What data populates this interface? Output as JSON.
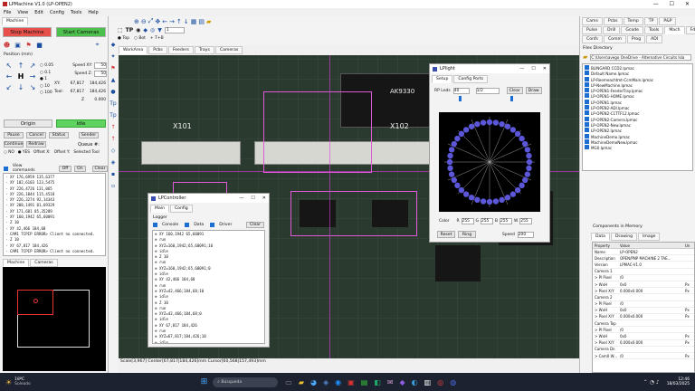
{
  "app": {
    "title": "LPMachine V1.0 (LP-OPEN2)",
    "menu": [
      "File",
      "View",
      "Edit",
      "Config",
      "Tools",
      "Help"
    ]
  },
  "left": {
    "machine_tab": "Machine",
    "stop": "Stop Machine",
    "start": "Start Cameras",
    "pos_title": "Position (mm)",
    "speeds": [
      {
        "l": "Speed XY:",
        "v": "50"
      },
      {
        "l": "Speed Z:",
        "v": "50"
      }
    ],
    "coords": [
      {
        "l": "XY:",
        "a": "67,817",
        "b": "184,426"
      },
      {
        "l": "Tool:",
        "a": "67,817",
        "b": "184,426"
      },
      {
        "l": "Z",
        "a": "",
        "b": "0.000"
      }
    ],
    "steps": [
      "0.05",
      "0.1",
      "1",
      "10",
      "100"
    ],
    "origin": "Origin",
    "status": "Idle",
    "pause": "Pause",
    "cancel": "Cancel",
    "status_btn": "Status",
    "sender": "Sender",
    "continue": "Continue",
    "redraw": "Redraw",
    "queue": "Queue #:",
    "radio_no": "NO",
    "radio_yes": "YES",
    "offset_x": "Offset X:",
    "offset_y": "Offset Y:",
    "selected_tool": "Selected Tool",
    "view_commands": "View commands",
    "off": "Off",
    "on": "On",
    "clear": "Clear",
    "log": [
      "XY 176,6959 135,6377",
      "XY 182,6103 123,5475",
      "XY 226,4726 131,065",
      "XY 226,1044 115,4518",
      "XY 226,3274 92,14343",
      "XY 208,1491 81,69329",
      "XY 171,681 85,35289",
      "XY 160,1942 65,60091",
      "Z 10",
      "XY 42,466 184,68",
      "CAM1 TCPIP ERROR> Client no connected.",
      "Z 10",
      "XY 67,817 184,426",
      "CAM1 TCPIP ERROR> Client no connected."
    ],
    "bottom_tabs": [
      "Machine",
      "Cameras"
    ]
  },
  "center": {
    "tabs": [
      "WorkArea",
      "Pcbs",
      "Feeders",
      "Trays",
      "Cameras"
    ],
    "top": "Top",
    "bot": "Bot",
    "tb": "+ T+B",
    "zoom": "1",
    "status": "Scale[3,967]   Center[67,817|184,426]mm   Cursor[60,568|157,493]mm",
    "pcb_labels": [
      "X101",
      "X102",
      "AK9330"
    ]
  },
  "lpc": {
    "title": "LPController",
    "tabs": [
      "Main",
      "Config"
    ],
    "logger": "Logger",
    "console": "Console",
    "data": "Data",
    "driver": "Driver",
    "clear": "Clear",
    "lines": [
      "XY 160,1942 65,60091",
      "run",
      "XYZ=160,1942;65,60091;10",
      "idle",
      "Z 10",
      "run",
      "XYZ=160,1942;65,60091;0",
      "idle",
      "XY 42,466 184,68",
      "run",
      "XYZ=42,466;184,68;10",
      "idle",
      "Z 10",
      "run",
      "XYZ=42,466;184,68;0",
      "idle",
      "XY 67,817 184,426",
      "run",
      "XYZ=67,817;184,426;10",
      "idle"
    ]
  },
  "lpl": {
    "title": "LPlight",
    "tabs": [
      "Setup",
      "Config Ports"
    ],
    "rp": "RP Leds",
    "rp_val": "40",
    "sel_val": "1/2",
    "clear": "Clear",
    "draw": "Draw",
    "color": "Color",
    "r": "R",
    "rv": "255",
    "g": "G",
    "gv": "255",
    "b": "B",
    "bv": "255",
    "w": "W",
    "wv": "255",
    "reset": "Reset",
    "ring": "Ring",
    "speed": "Speed",
    "speed_v": "200"
  },
  "right": {
    "tabs1": [
      "Cams",
      "Pcbs",
      "Temp",
      "TP",
      "P&P"
    ],
    "tabs2": [
      "Pulse",
      "Drill",
      "Gcode",
      "Tools",
      "Mach",
      "Fdrs"
    ],
    "tabs3": [
      "Confs",
      "Comm",
      "Prog",
      "ADI"
    ],
    "dir_title": "Files Directory",
    "path": "C:\\Users\\avego OneDrive - Alternative Circuits Isla",
    "files": [
      "BLINGARD CCD2.lpmac",
      "Default Name.lpmac",
      "LP-Reemeachtmt-CcmMain.lpmac",
      "LP-NewMachine.lpmac",
      "LP-OPEN1-FeederTray.lpmac",
      "LP-OPEN1-HOME.lpmac",
      "LP-OPEN1.lpmac",
      "LP-OPEN2-ADI.lpmac",
      "LP-OPEN2-C1TTF12.lpmac",
      "LP-OPEN2-Camera.lpmac",
      "LP-OPEN2-New.lpmac",
      "LP-OPEN2.lpmac",
      "MachineDemo.lpmac",
      "MachineDemoNew.lpmac",
      "MG0.lpmac"
    ],
    "comp_title": "Components in Memory",
    "comp_tabs": [
      "Data",
      "Drawing",
      "Image"
    ],
    "hdr": [
      "Property",
      "Value",
      "Un"
    ],
    "props": [
      [
        "Name",
        "LP-OPEN2",
        ""
      ],
      [
        "Description",
        "OPEN/PNP MACHINE 2 TAE...",
        ""
      ],
      [
        "Version",
        "LPMAC-V1.0",
        ""
      ],
      [
        "Camera 1",
        "",
        ""
      ],
      [
        "> Pl Pixel",
        "/0",
        ""
      ],
      [
        "> WxH",
        "0x0",
        "Px"
      ],
      [
        "> Pixel X/Y",
        "0.000x0.000",
        "Px"
      ],
      [
        "Camera 2",
        "",
        ""
      ],
      [
        "> Pl Pixel",
        "/0",
        ""
      ],
      [
        "> WxH",
        "0x0",
        "Px"
      ],
      [
        "> Pixel X/Y",
        "0.000x0.000",
        "Px"
      ],
      [
        "Camera Top",
        "",
        ""
      ],
      [
        "> Pl Pixel",
        "/0",
        ""
      ],
      [
        "> WxH",
        "0x0",
        "Px"
      ],
      [
        "> Pixel X/Y",
        "0.000x0.000",
        "Px"
      ],
      [
        "Camera Dn",
        "",
        ""
      ],
      [
        "> Cam0 W...",
        "/0",
        "Px"
      ]
    ]
  },
  "taskbar": {
    "temp": "18ºC",
    "weather": "Soleado",
    "search": "Búsqueda",
    "time": "12:46",
    "date": "18/03/2025"
  },
  "colors": {
    "stop": "#e8504b",
    "start": "#4cc04c",
    "origin": "#e8e8e8",
    "idle": "#5fd35f",
    "pcb": "#1f2a22",
    "ring": "#5b57d8"
  }
}
